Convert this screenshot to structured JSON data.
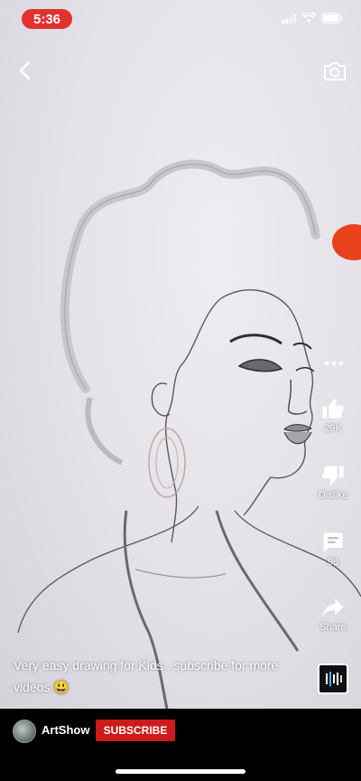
{
  "status_bar": {
    "time": "5:36"
  },
  "actions": {
    "like_count": "29K",
    "dislike_label": "Dislike",
    "comment_count": "98",
    "share_label": "Share"
  },
  "video": {
    "caption": "Very easy drawing for Kids . subscribe for more videos 😃"
  },
  "channel": {
    "name": "ArtShow",
    "subscribe_label": "SUBSCRIBE"
  },
  "colors": {
    "time_pill": "#e2322f",
    "subscribe": "#cc1a1a",
    "marker_tip": "#e8411c"
  },
  "icons": [
    "back-icon",
    "camera-icon",
    "more-icon",
    "like-icon",
    "dislike-icon",
    "comment-icon",
    "share-icon",
    "sound-icon",
    "wifi-icon",
    "battery-icon",
    "signal-icon"
  ]
}
